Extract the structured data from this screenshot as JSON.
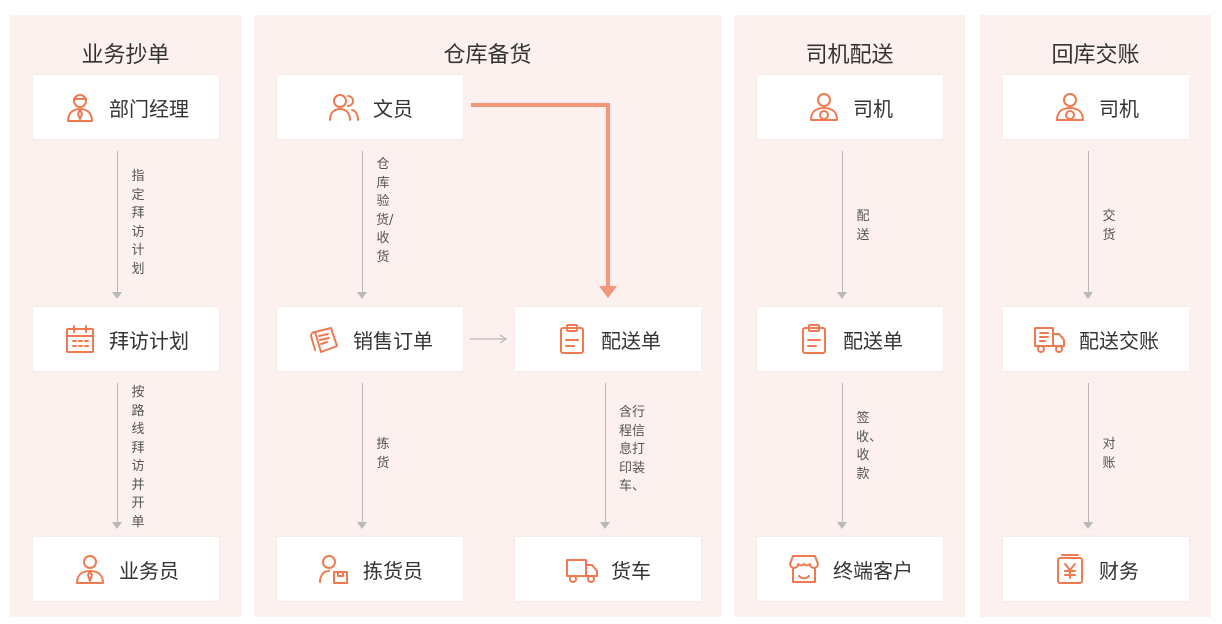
{
  "columns": [
    {
      "title": "业务抄单"
    },
    {
      "title": "仓库备货"
    },
    {
      "title": "司机配送"
    },
    {
      "title": "回库交账"
    }
  ],
  "boxes": {
    "manager": "部门经理",
    "visit_plan": "拜访计划",
    "salesman": "业务员",
    "clerk": "文员",
    "sales_order": "销售订单",
    "delivery_note_wh": "配送单",
    "picker": "拣货员",
    "truck": "货车",
    "driver_delivery": "司机",
    "delivery_note_drv": "配送单",
    "end_customer": "终端客户",
    "driver_return": "司机",
    "delivery_settle": "配送交账",
    "finance": "财务"
  },
  "edges": {
    "assign_plan": "指定拜访计划",
    "visit_route": "按路线拜访并开单",
    "inspect_receive": "仓库验货/收货",
    "pick": "拣货",
    "print_load": "含行程信息打印装车、",
    "deliver": "配送",
    "sign_collect": "签收、收款",
    "handover": "交货",
    "reconcile": "对账"
  },
  "icons": [
    "manager-icon",
    "calendar-icon",
    "salesman-icon",
    "users-icon",
    "order-papers-icon",
    "clipboard-icon",
    "picker-icon",
    "truck-icon",
    "driver-icon",
    "store-icon",
    "delivery-truck-icon",
    "yen-doc-icon"
  ],
  "colors": {
    "accent": "#ef7a52",
    "panel_bg": "#fcf1ee",
    "arrow_orange": "#f3967a",
    "line_gray": "#b9b9b9"
  }
}
